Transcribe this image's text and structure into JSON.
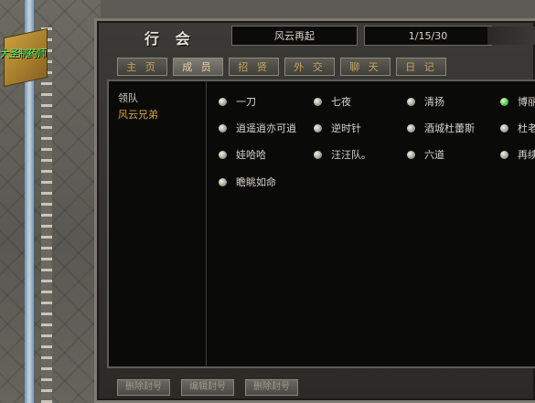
{
  "world": {
    "npc_label": "大圣制药师"
  },
  "guild_window": {
    "title": "行 会",
    "guild_name": "风云再起",
    "date": "1/15/30",
    "tabs": [
      {
        "label": "主 页",
        "active": false
      },
      {
        "label": "成 员",
        "active": true
      },
      {
        "label": "招 贤",
        "active": false
      },
      {
        "label": "外 交",
        "active": false
      },
      {
        "label": "聊 天",
        "active": false
      },
      {
        "label": "日 记",
        "active": false
      }
    ],
    "groups": [
      "领队",
      "风云兄弟"
    ],
    "members": [
      {
        "name": "一刀",
        "online": false
      },
      {
        "name": "七夜",
        "online": false
      },
      {
        "name": "清扬",
        "online": false
      },
      {
        "name": "博丽",
        "online": true
      },
      {
        "name": "逍遥逍亦可逍",
        "online": false
      },
      {
        "name": "逆时针",
        "online": false
      },
      {
        "name": "酒城杜蕾斯",
        "online": false
      },
      {
        "name": "杜老",
        "online": false
      },
      {
        "name": "娃哈哈",
        "online": false
      },
      {
        "name": "汪汪队。",
        "online": false
      },
      {
        "name": "六道",
        "online": false
      },
      {
        "name": "再续",
        "online": false
      },
      {
        "name": "瞻眺如命",
        "online": false
      }
    ],
    "buttons": [
      "删除封号",
      "编辑封号",
      "删除封号"
    ]
  }
}
